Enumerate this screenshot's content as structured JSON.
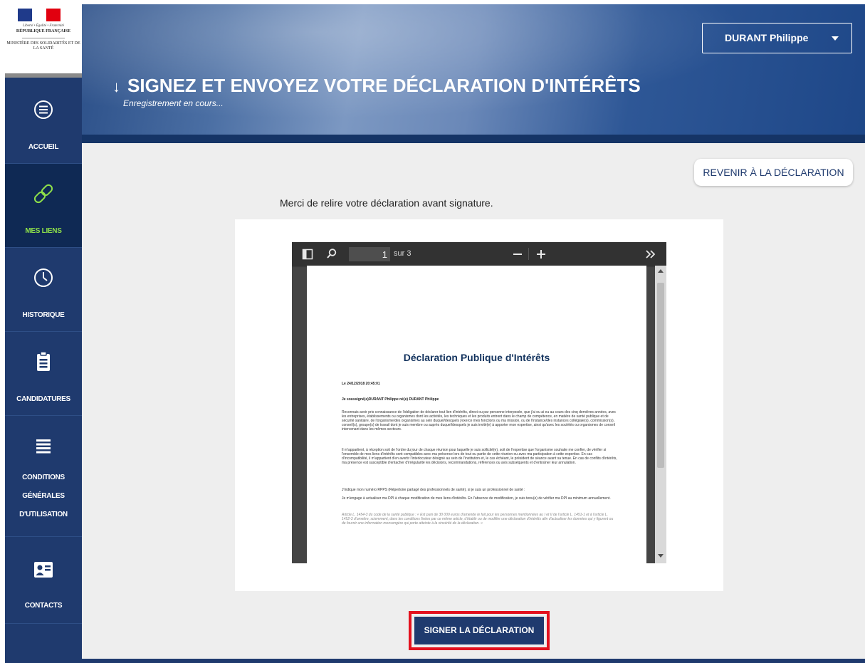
{
  "logo": {
    "motto": "Liberté • Égalité • Fraternité",
    "republic": "RÉPUBLIQUE FRANÇAISE",
    "ministry": "MINISTÈRE DES SOLIDARITÉS ET DE LA SANTÉ"
  },
  "sidebar": {
    "items": [
      {
        "label": "ACCUEIL",
        "icon": "list-circle-icon",
        "active": false
      },
      {
        "label": "MES LIENS",
        "icon": "link-icon",
        "active": true
      },
      {
        "label": "HISTORIQUE",
        "icon": "clock-icon",
        "active": false
      },
      {
        "label": "CANDIDATURES",
        "icon": "clipboard-icon",
        "active": false
      },
      {
        "label_lines": [
          "CONDITIONS",
          "GÉNÉRALES",
          "D'UTILISATION"
        ],
        "icon": "menu-lines-icon",
        "active": false
      },
      {
        "label": "CONTACTS",
        "icon": "contact-card-icon",
        "active": false
      }
    ]
  },
  "header": {
    "title": "SIGNEZ ET ENVOYEZ VOTRE DÉCLARATION D'INTÉRÊTS",
    "subtitle": "Enregistrement en cours...",
    "user": "DURANT Philippe"
  },
  "main": {
    "back_button": "REVENIR À LA DÉCLARATION",
    "intro": "Merci de relire votre déclaration avant signature.",
    "sign_button": "SIGNER LA DÉCLARATION"
  },
  "viewer": {
    "page_current": "1",
    "page_of": "sur 3",
    "doc": {
      "title": "Déclaration Publique d'Intérêts",
      "date_line": "Le 24/12/2018 20:45:01",
      "signatory_line": "Je soussigné(e)DURANT Philippe né(e) DURANT Philippe",
      "paragraph1": "Reconnais avoir pris connaissance de l'obligation de déclarer tout lien d'intérêts, direct ou par personne interposée, que j'ai ou ai eu au cours des cinq dernières années, avec les entreprises, établissements ou organismes dont les activités, les techniques et les produits entrent dans le champ de compétence, en matière de santé publique et de sécurité sanitaire, de l'organisme/des organismes au sein duquel/desquels j'exerce mes fonctions ou ma mission, ou de l'instance/des instances collégiale(s), commission(s), conseil(s), groupe(s) de travail dont je suis membre ou auprès duquel/desquels je suis invité(e) à apporter mon expertise, ainsi qu'avec les sociétés ou organismes de conseil intervenant dans les mêmes secteurs.",
      "paragraph2": "Il m'appartient, à réception soit de l'ordre du jour de chaque réunion pour laquelle je suis sollicité(e), soit de l'expertise que l'organisme souhaite me confier, de vérifier si l'ensemble de mes liens d'intérêts sont compatibles avec ma présence lors de tout ou partie de cette réunion ou avec ma participation à cette expertise. En cas d'incompatibilité, il m'appartient d'en avertir l'interlocuteur désigné au sein de l'institution et, le cas échéant, le président de séance avant sa tenue. En cas de conflits d'intérêts, ma présence est susceptible d'entacher d'irrégularité les décisions, recommandations, références ou avis subséquents et d'entraîner leur annulation.",
      "rpps_line": "J'indique mon numéro RPPS (Répertoire partagé des professionnels de santé), si je suis un professionnel de santé :",
      "paragraph3": "Je m'engage à actualiser ma DPI à chaque modification de mes liens d'intérêts. En l'absence de modification, je suis tenu(e) de vérifier ma DPI au minimum annuellement.",
      "article": "Article L. 1454-3 du code de la santé publique : « Est puni de 30 000 euros d'amende le fait pour les personnes mentionnées au I et II de l'article L. 1451-1 et à l'article L. 1452-3 d'omettre, sciemment, dans les conditions fixées par ce même article, d'établir ou de modifier une déclaration d'intérêts afin d'actualiser les données qui y figurent ou de fournir une information mensongère qui porte atteinte à la sincérité de la déclaration. »"
    }
  },
  "colors": {
    "sidebar": "#1f3a6e",
    "active_label": "#8ee04a",
    "sign_highlight": "#e3111e"
  }
}
